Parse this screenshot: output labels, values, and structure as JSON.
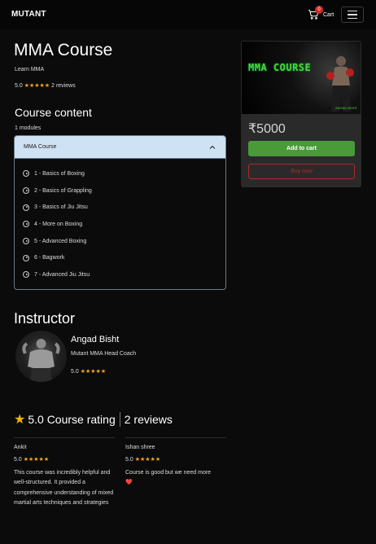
{
  "nav": {
    "brand": "MUTANT",
    "cart_label": "Cart",
    "cart_count": "0"
  },
  "course": {
    "title": "MMA Course",
    "subtitle": "Learn MMA",
    "rating": "5.0",
    "stars": "★★★★★",
    "reviews_label": "2 reviews"
  },
  "content": {
    "heading": "Course content",
    "modules_count": "1 modules",
    "module_title": "MMA Course",
    "lessons": [
      "1 - Basics of Boxing",
      "2 - Basics of Grappling",
      "3 - Basics of Jiu Jitsu",
      "4 - More on Boxing",
      "5 - Advanced Boxing",
      "6 - Bagwork",
      "7 - Advanced Jiu Jitsu"
    ]
  },
  "card": {
    "thumb_title": "MMA COURSE",
    "thumb_tag": "ANGAD BISHT",
    "price": "₹5000",
    "add_to_cart": "Add to cart",
    "buy_now": "Buy now"
  },
  "instructor": {
    "heading": "Instructor",
    "name": "Angad Bisht",
    "role": "Mutant MMA Head Coach",
    "rating": "5.0",
    "stars": "★★★★★"
  },
  "ratings": {
    "star": "★",
    "score_label": "5.0 Course rating",
    "reviews_label": "2 reviews",
    "reviews": [
      {
        "name": "Ankit",
        "rating": "5.0",
        "stars": "★★★★★",
        "text": "This course was incredibly helpful and well-structured. It provided a comprehensive understanding of mixed martial arts techniques and strategies"
      },
      {
        "name": "Ishan shree",
        "rating": "5.0",
        "stars": "★★★★★",
        "text": "Course is good but we need more",
        "emoji": "❤️"
      }
    ]
  },
  "colors": {
    "accent_green": "#4a9a3a",
    "buy_red": "#b02a2a",
    "star_gold": "#f5a623",
    "accordion_header": "#cfe2f3"
  }
}
